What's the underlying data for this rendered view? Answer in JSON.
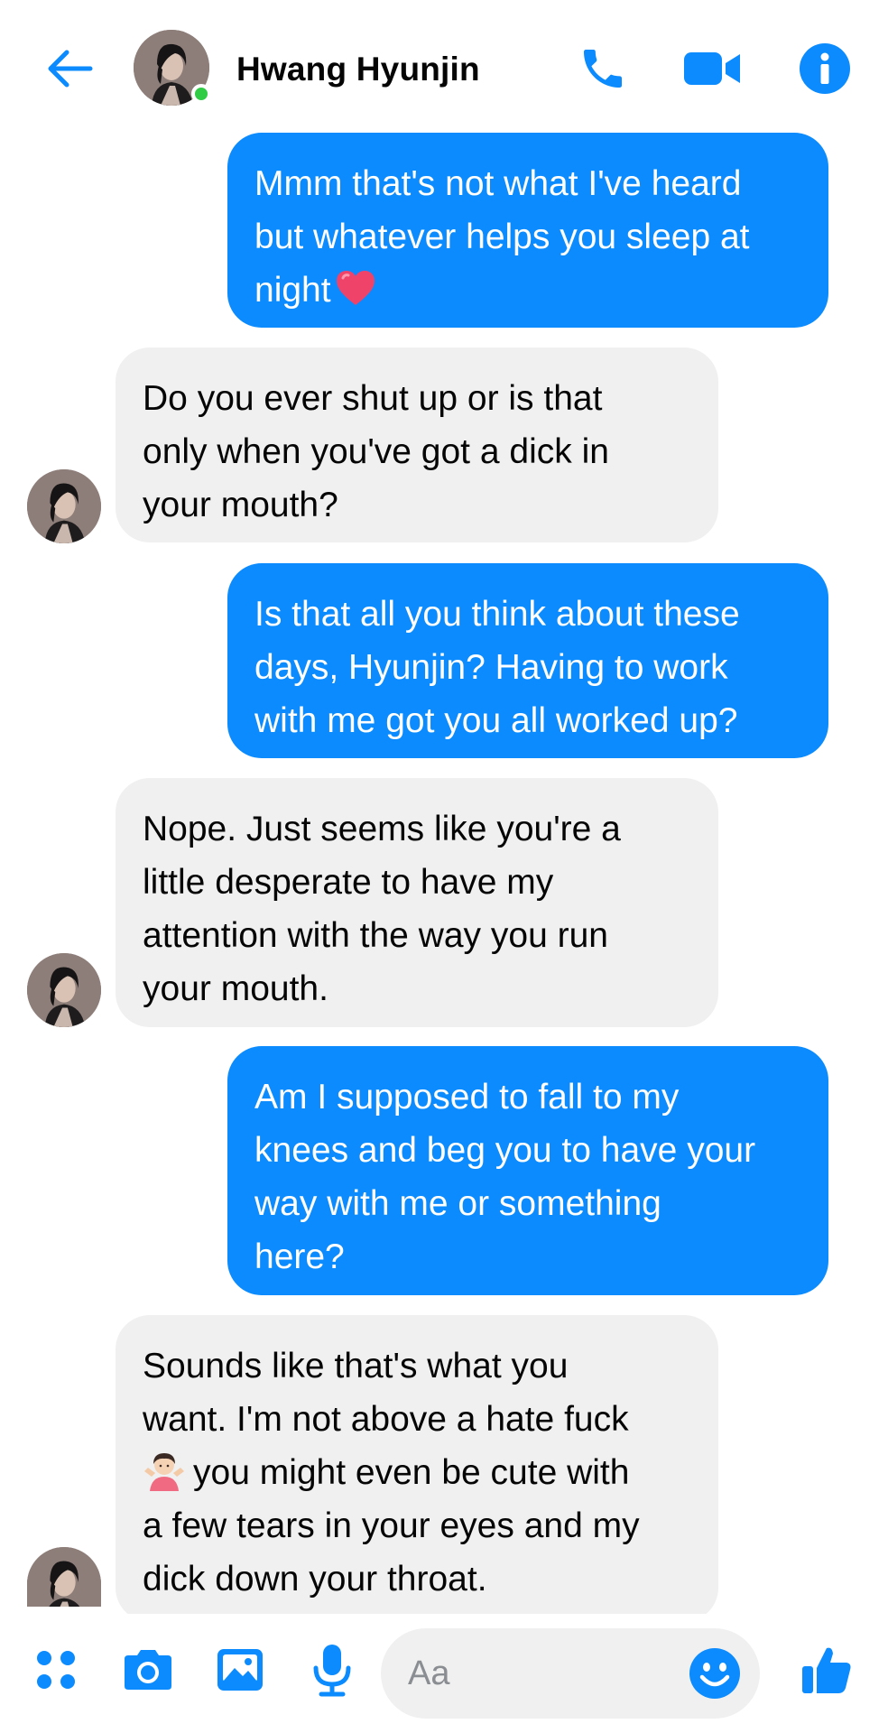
{
  "header": {
    "contact_name": "Hwang Hyunjin",
    "online": true,
    "accent_color": "#0b8bfd",
    "icons": [
      "back-arrow-icon",
      "phone-icon",
      "video-camera-icon",
      "info-icon"
    ]
  },
  "messages": [
    {
      "direction": "outgoing",
      "lines": [
        "Mmm that's not what I've heard",
        "but whatever helps you sleep at",
        "night"
      ],
      "emoji": "heart"
    },
    {
      "direction": "incoming",
      "lines": [
        "Do you ever shut up or is that",
        "only when you've got a dick in",
        "your mouth?"
      ]
    },
    {
      "direction": "outgoing",
      "lines": [
        "Is that all you think about these",
        "days, Hyunjin? Having to work",
        "with me got you all worked up?"
      ]
    },
    {
      "direction": "incoming",
      "lines": [
        "Nope. Just seems like you're a",
        "little desperate to have my",
        "attention with the way you run",
        "your mouth."
      ]
    },
    {
      "direction": "outgoing",
      "lines": [
        "Am I supposed to fall to my",
        "knees and beg you to have your",
        "way with me or something",
        "here?"
      ]
    },
    {
      "direction": "incoming",
      "lines": [
        "Sounds like that's what you",
        "want. I'm not above a hate fuck",
        "you might even be cute with",
        "a few tears in your eyes and my",
        "dick down your throat."
      ],
      "emoji": "person-shrugging"
    }
  ],
  "composer": {
    "placeholder": "Aa",
    "icons": [
      "apps-icon",
      "camera-icon",
      "gallery-icon",
      "microphone-icon",
      "emoji-icon",
      "thumbs-up-icon"
    ]
  },
  "colors": {
    "outgoing_bubble": "#0b8bfd",
    "incoming_bubble": "#f0f0f0",
    "online_dot": "#31cc46"
  }
}
